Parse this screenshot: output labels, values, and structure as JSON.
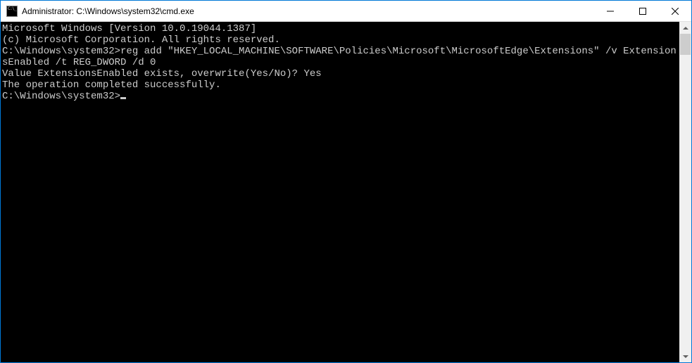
{
  "window": {
    "title": "Administrator: C:\\Windows\\system32\\cmd.exe"
  },
  "console": {
    "header1": "Microsoft Windows [Version 10.0.19044.1387]",
    "header2": "(c) Microsoft Corporation. All rights reserved.",
    "blank1": "",
    "cmd1_prompt": "C:\\Windows\\system32>",
    "cmd1_command": "reg add \"HKEY_LOCAL_MACHINE\\SOFTWARE\\Policies\\Microsoft\\MicrosoftEdge\\Extensions\" /v ExtensionsEnabled /t REG_DWORD /d 0",
    "out1": "Value ExtensionsEnabled exists, overwrite(Yes/No)? Yes",
    "out2": "The operation completed successfully.",
    "blank2": "",
    "cmd2_prompt": "C:\\Windows\\system32>"
  }
}
